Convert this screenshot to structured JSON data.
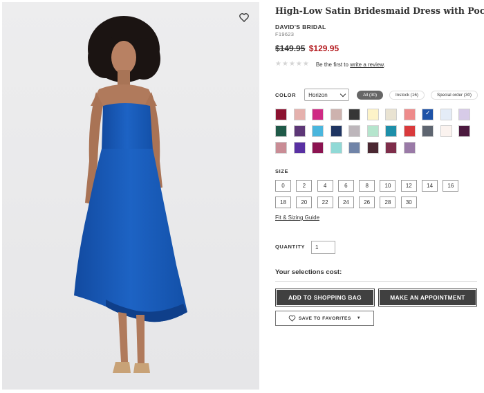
{
  "product": {
    "title": "High-Low Satin Bridesmaid Dress with Pockets",
    "brand": "DAVID'S BRIDAL",
    "sku": "F19623",
    "price_old": "$149.95",
    "price_new": "$129.95",
    "rating_prompt": "Be the first to",
    "rating_link": "write a review",
    "rating_suffix": "."
  },
  "color": {
    "label": "COLOR",
    "selected": "Horizon",
    "filters": [
      "All (30)",
      "Instock (16)",
      "Special order (30)"
    ],
    "active_filter": 0,
    "swatches": [
      "#8b1230",
      "#e5b1ad",
      "#cf2a84",
      "#cdb2ae",
      "#363636",
      "#fdf3c8",
      "#e9e3d2",
      "#ee8b8b",
      "#1d52a7",
      "#e4ecf7",
      "#d7cbe8",
      "#1f5a48",
      "#5d3777",
      "#4ab6dd",
      "#1f3562",
      "#bdb6bb",
      "#b5e5cd",
      "#1d8fa9",
      "#d93a3c",
      "#5e6570",
      "#fbf3ef",
      "#4c1a3f",
      "#c98c95",
      "#5930a3",
      "#8c1351",
      "#90d9d6",
      "#7084a8",
      "#4a2731",
      "#7e2d4a",
      "#9a7aa7"
    ],
    "selected_swatch": 8
  },
  "size": {
    "label": "SIZE",
    "options": [
      "0",
      "2",
      "4",
      "6",
      "8",
      "10",
      "12",
      "14",
      "16",
      "18",
      "20",
      "22",
      "24",
      "26",
      "28",
      "30"
    ],
    "fit_link": "Fit & Sizing Guide"
  },
  "quantity": {
    "label": "QUANTITY",
    "value": "1"
  },
  "cost_label": "Your selections cost:",
  "buttons": {
    "add_to_bag": "ADD TO SHOPPING BAG",
    "appointment": "MAKE AN APPOINTMENT",
    "favorites": "SAVE TO FAVORITES"
  },
  "icons": {
    "favorite": "heart-outline-icon",
    "caret": "caret-down-icon",
    "dropdown": "chevron-down-icon",
    "rating": "star-icon"
  },
  "colors": {
    "sale_red": "#b3171c",
    "button_dark": "#404040",
    "dress_blue": "#1a5bb5"
  }
}
